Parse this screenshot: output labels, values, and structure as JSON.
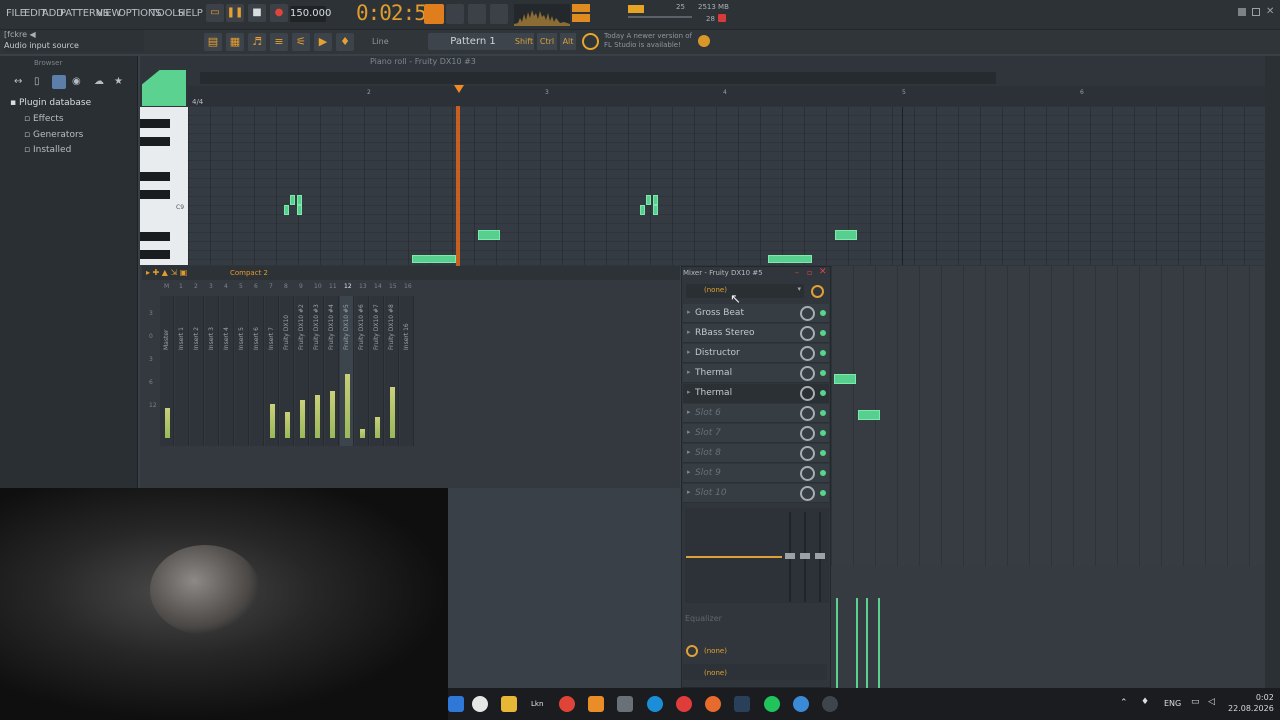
{
  "menu": [
    "FILE",
    "EDIT",
    "ADD",
    "PATTERNS",
    "VIEW",
    "OPTIONS",
    "TOOLS",
    "HELP"
  ],
  "transport": {
    "tempo": "150.000",
    "time": "0:02:51",
    "cpu": "25",
    "ram": "2513 MB",
    "polyphony": "28"
  },
  "hint": {
    "line1": "[fckre ◀",
    "line2": "Audio input source"
  },
  "toolbar": {
    "snap": "Line",
    "pattern": "Pattern 1",
    "shift": "Shift",
    "ctrl": "Ctrl",
    "alt": "Alt",
    "news_line1": "Today  A newer version of",
    "news_line2": "FL Studio is available!"
  },
  "browser": {
    "title": "Browser",
    "items": [
      "Plugin database",
      "Effects",
      "Generators",
      "Installed"
    ]
  },
  "pianoroll": {
    "title": "Piano roll - Fruity DX10 #3",
    "timesig": "4/4",
    "key": "C9",
    "bars": [
      "2",
      "3",
      "4",
      "5",
      "6"
    ]
  },
  "mixer_compact": {
    "title": "Compact 2",
    "channels": [
      "Master",
      "Insert 1",
      "Insert 2",
      "Insert 3",
      "Insert 4",
      "Insert 5",
      "Insert 6",
      "Insert 7",
      "Fruity DX10",
      "Fruity DX10 #2",
      "Fruity DX10 #3",
      "Fruity DX10 #4",
      "Fruity DX10 #5",
      "Fruity DX10 #6",
      "Fruity DX10 #7",
      "Fruity DX10 #8",
      "Insert 16"
    ],
    "numbers": [
      "M",
      "1",
      "2",
      "3",
      "4",
      "5",
      "6",
      "7",
      "8",
      "9",
      "10",
      "11",
      "12",
      "13",
      "14",
      "15",
      "16"
    ],
    "scale": [
      "3",
      "0",
      "3",
      "6",
      "12"
    ]
  },
  "mixer_panel": {
    "title": "Mixer - Fruity DX10 #5",
    "input": "(none)",
    "slots": [
      {
        "label": "Gross Beat",
        "empty": false
      },
      {
        "label": "RBass Stereo",
        "empty": false
      },
      {
        "label": "Distructor",
        "empty": false
      },
      {
        "label": "Thermal",
        "empty": false
      },
      {
        "label": "Thermal",
        "empty": false
      },
      {
        "label": "Slot 6",
        "empty": true
      },
      {
        "label": "Slot 7",
        "empty": true
      },
      {
        "label": "Slot 8",
        "empty": true
      },
      {
        "label": "Slot 9",
        "empty": true
      },
      {
        "label": "Slot 10",
        "empty": true
      }
    ],
    "eq": "Equalizer",
    "output1": "(none)",
    "output2": "(none)"
  },
  "taskbar": {
    "lang": "ENG",
    "time": "0:02",
    "date": "22.08.2026",
    "lkn": "Lkn"
  }
}
